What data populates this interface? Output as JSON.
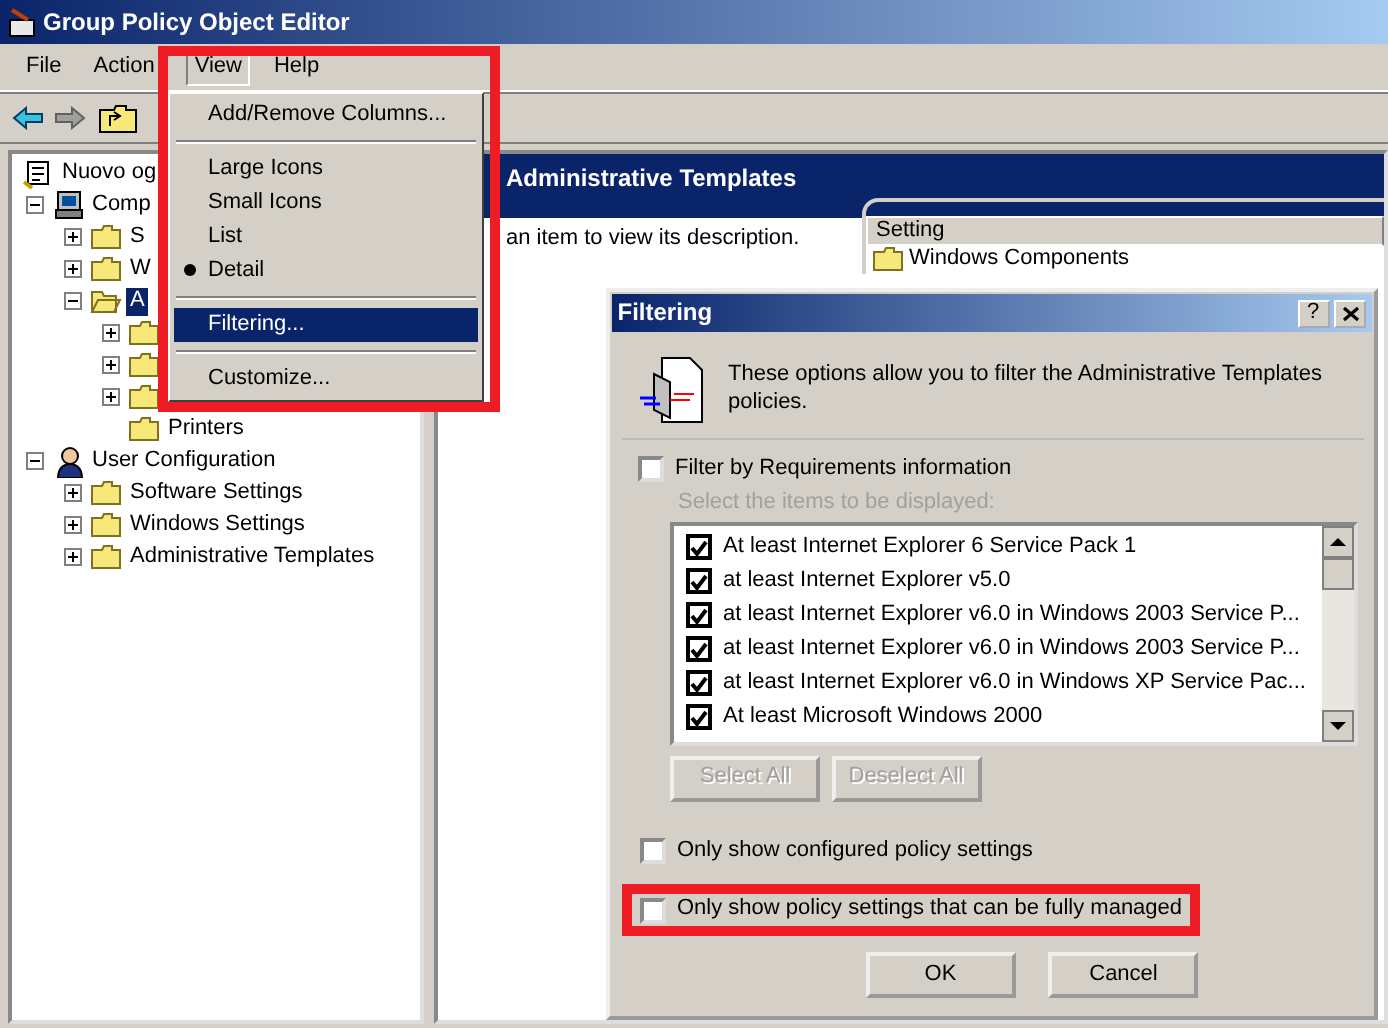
{
  "window": {
    "title": "Group Policy Object Editor"
  },
  "menu_bar": [
    {
      "label": "File",
      "selected": false
    },
    {
      "label": "Action",
      "selected": false
    },
    {
      "label": "View",
      "selected": true
    },
    {
      "label": "Help",
      "selected": false
    }
  ],
  "tree": [
    {
      "label": "Nuovo og",
      "selected": false,
      "children": [
        {
          "label": "Comp",
          "expanded": true,
          "selected": false,
          "children": [
            {
              "label": "S",
              "expanded": false,
              "selected": false
            },
            {
              "label": "W",
              "expanded": false,
              "selected": false
            },
            {
              "label": "A",
              "expanded": true,
              "selected": true,
              "children": [
                {
                  "expanded": false,
                  "selected": false
                },
                {
                  "expanded": false,
                  "selected": false
                },
                {
                  "expanded": false,
                  "selected": false
                },
                {
                  "label": "Printers",
                  "selected": false
                }
              ]
            }
          ]
        },
        {
          "label": "User Configuration",
          "expanded": true,
          "selected": false,
          "children": [
            {
              "label": "Software Settings",
              "expanded": false,
              "selected": false
            },
            {
              "label": "Windows Settings",
              "expanded": false,
              "selected": false
            },
            {
              "label": "Administrative Templates",
              "expanded": false,
              "selected": false
            }
          ]
        }
      ]
    }
  ],
  "right_pane": {
    "title": "Administrative Templates",
    "description": "an item to view its description.",
    "columns": [
      "Setting"
    ],
    "rows": [
      "Windows Components"
    ]
  },
  "view_menu": {
    "highlight": true,
    "items": [
      {
        "kind": "item",
        "label": "Add/Remove Columns...",
        "selected": false
      },
      {
        "kind": "separator"
      },
      {
        "kind": "radio",
        "label": "Large Icons",
        "checked": false,
        "selected": false
      },
      {
        "kind": "radio",
        "label": "Small Icons",
        "checked": false,
        "selected": false
      },
      {
        "kind": "radio",
        "label": "List",
        "checked": false,
        "selected": false
      },
      {
        "kind": "radio",
        "label": "Detail",
        "checked": true,
        "selected": false
      },
      {
        "kind": "separator"
      },
      {
        "kind": "item",
        "label": "Filtering...",
        "selected": true
      },
      {
        "kind": "separator"
      },
      {
        "kind": "item",
        "label": "Customize...",
        "selected": false
      }
    ]
  },
  "dialog": {
    "title": "Filtering",
    "help_button": "?",
    "intro": "These options allow you to filter the Administrative Templates policies.",
    "filter_checkbox": {
      "label": "Filter by Requirements information",
      "checked": false
    },
    "list_label": {
      "text": "Select the items to be displayed:",
      "disabled": true
    },
    "requirements": [
      {
        "label": "At least Internet Explorer 6 Service Pack 1",
        "checked": true
      },
      {
        "label": "at least Internet Explorer v5.0",
        "checked": true
      },
      {
        "label": "at least Internet Explorer v6.0 in Windows 2003 Service P...",
        "checked": true
      },
      {
        "label": "at least Internet Explorer v6.0 in Windows 2003 Service P...",
        "checked": true
      },
      {
        "label": "at least Internet Explorer v6.0 in Windows XP Service Pac...",
        "checked": true
      },
      {
        "label": "At least Microsoft Windows 2000",
        "checked": true
      }
    ],
    "list_buttons": [
      {
        "label": "Select All",
        "disabled": true
      },
      {
        "label": "Deselect All",
        "disabled": true
      }
    ],
    "options": [
      {
        "label": "Only show configured policy settings",
        "checked": false,
        "highlight": false
      },
      {
        "label": "Only show policy settings that can be fully managed",
        "checked": false,
        "highlight": true
      }
    ],
    "buttons": [
      "OK",
      "Cancel"
    ]
  }
}
